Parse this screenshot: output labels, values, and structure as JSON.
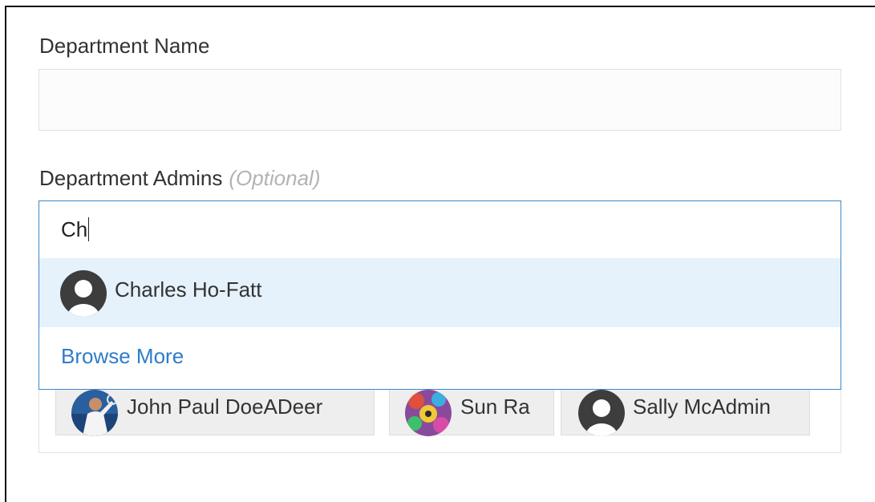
{
  "form": {
    "department_name": {
      "label": "Department Name",
      "value": ""
    },
    "department_admins": {
      "label": "Department Admins",
      "optional_tag": "(Optional)",
      "search_value": "Ch"
    }
  },
  "dropdown": {
    "suggestions": [
      {
        "name": "Charles Ho-Fatt",
        "avatar": "default-user-icon"
      }
    ],
    "browse_more": "Browse More"
  },
  "selected_admins": [
    {
      "name": "John Paul DoeADeer",
      "avatar": "photo-tennis-player"
    },
    {
      "name": "Sun Ra",
      "avatar": "photo-colorful-art"
    },
    {
      "name": "Sally McAdmin",
      "avatar": "default-user-icon"
    }
  ],
  "colors": {
    "accent": "#2f7cc8",
    "input_focus_border": "#3d86cc",
    "highlight_row": "#e5f1fb",
    "chip_bg": "#eeeeee",
    "optional_text": "#b3b3b3"
  }
}
